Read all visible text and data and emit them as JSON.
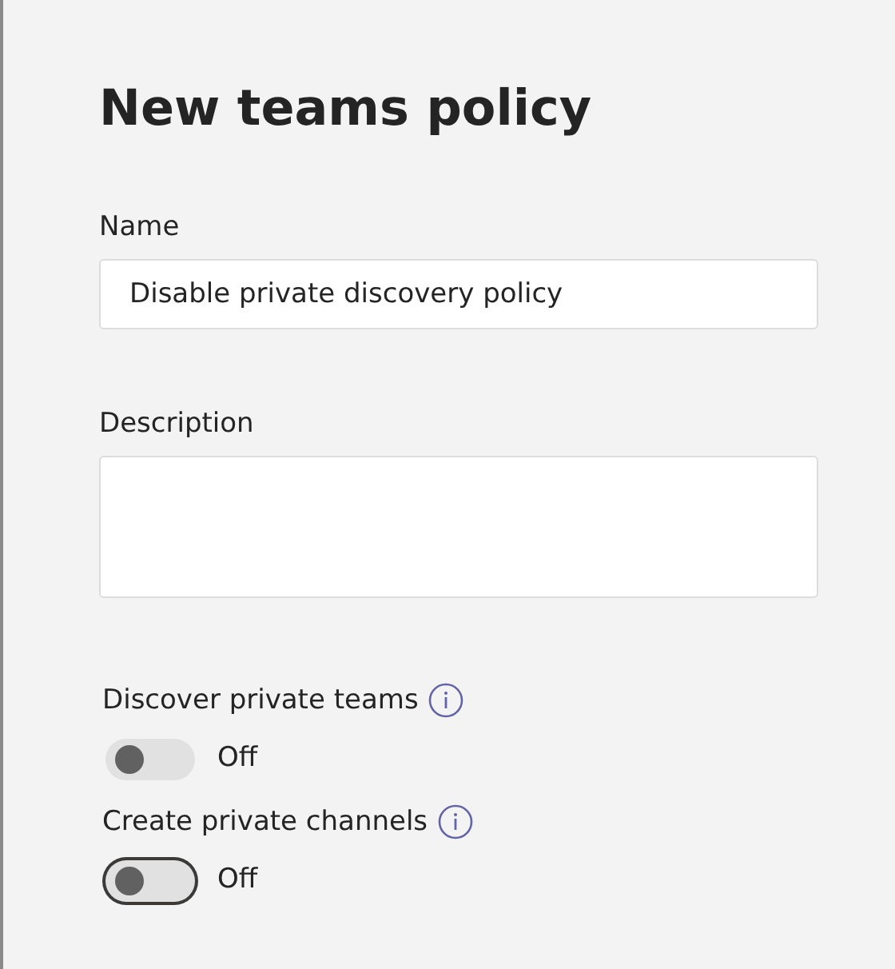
{
  "title": "New teams policy",
  "fields": [
    {
      "label": "Name",
      "value": "Disable private discovery policy",
      "kind": "input"
    },
    {
      "label": "Description",
      "kind": "textarea"
    }
  ],
  "settings": [
    {
      "label": "Discover private teams",
      "on": false,
      "kind": "plain",
      "state_text": "Off"
    },
    {
      "label": "Create private channels",
      "on": false,
      "kind": "focused",
      "state_text": "Off"
    }
  ]
}
